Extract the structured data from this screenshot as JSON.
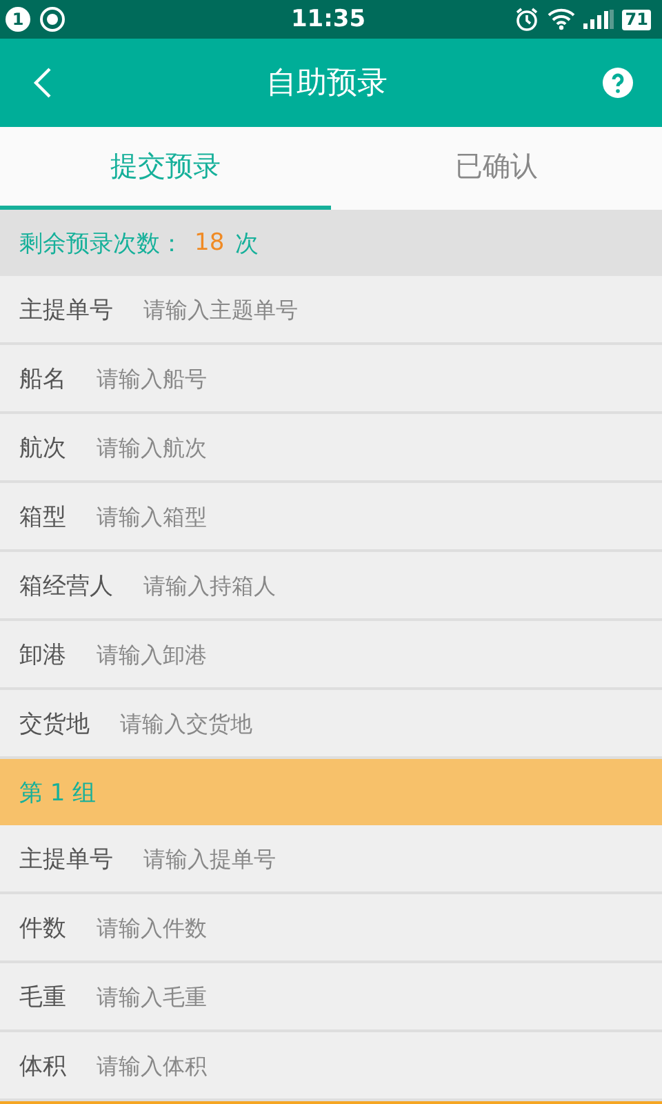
{
  "status_bar": {
    "notification_count": "1",
    "time": "11:35",
    "battery": "71"
  },
  "header": {
    "title": "自助预录"
  },
  "tabs": [
    {
      "label": "提交预录",
      "selected": true
    },
    {
      "label": "已确认",
      "selected": false
    }
  ],
  "quota": {
    "label": "剩余预录次数：",
    "count": "18",
    "unit": "次"
  },
  "fields": [
    {
      "label": "主提单号",
      "placeholder": "请输入主题单号"
    },
    {
      "label": "船名",
      "placeholder": "请输入船号"
    },
    {
      "label": "航次",
      "placeholder": "请输入航次"
    },
    {
      "label": "箱型",
      "placeholder": "请输入箱型"
    },
    {
      "label": "箱经营人",
      "placeholder": "请输入持箱人"
    },
    {
      "label": "卸港",
      "placeholder": "请输入卸港"
    },
    {
      "label": "交货地",
      "placeholder": "请输入交货地"
    }
  ],
  "groups": [
    {
      "title": "第 1 组",
      "fields": [
        {
          "label": "主提单号",
          "placeholder": "请输入提单号"
        },
        {
          "label": "件数",
          "placeholder": "请输入件数"
        },
        {
          "label": "毛重",
          "placeholder": "请输入毛重"
        },
        {
          "label": "体积",
          "placeholder": "请输入体积"
        }
      ]
    }
  ]
}
